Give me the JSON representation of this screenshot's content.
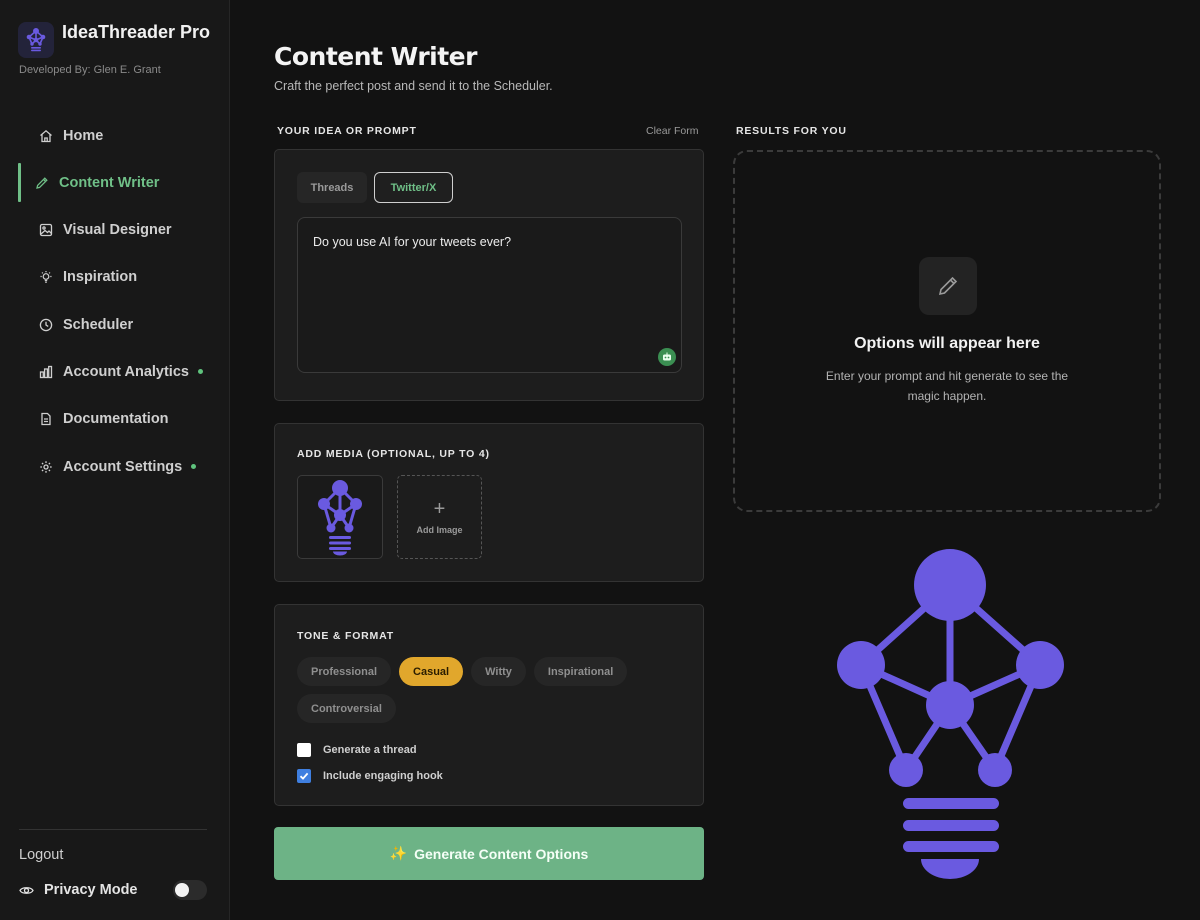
{
  "brand": {
    "title": "IdeaThreader Pro",
    "developer": "Developed By: Glen E. Grant"
  },
  "nav": {
    "items": [
      {
        "label": "Home",
        "icon": "home-icon",
        "active": false,
        "dot": false
      },
      {
        "label": "Content Writer",
        "icon": "pencil-icon",
        "active": true,
        "dot": false
      },
      {
        "label": "Visual Designer",
        "icon": "image-icon",
        "active": false,
        "dot": false
      },
      {
        "label": "Inspiration",
        "icon": "lightbulb-icon",
        "active": false,
        "dot": false
      },
      {
        "label": "Scheduler",
        "icon": "clock-icon",
        "active": false,
        "dot": false
      },
      {
        "label": "Account Analytics",
        "icon": "bar-chart-icon",
        "active": false,
        "dot": true
      },
      {
        "label": "Documentation",
        "icon": "document-icon",
        "active": false,
        "dot": false
      },
      {
        "label": "Account Settings",
        "icon": "settings-icon",
        "active": false,
        "dot": true
      }
    ],
    "logout": "Logout",
    "privacy_mode": "Privacy Mode",
    "privacy_enabled": false
  },
  "header": {
    "title": "Content Writer",
    "subtitle": "Craft the perfect post and send it to the Scheduler."
  },
  "prompt": {
    "label": "Your Idea or Prompt",
    "clear_label": "Clear Form",
    "tabs": [
      "Threads",
      "Twitter/X"
    ],
    "active_tab": "Twitter/X",
    "value": "Do you use AI for your tweets ever?"
  },
  "media": {
    "label": "ADD MEDIA (OPTIONAL, UP TO 4)",
    "add_label": "Add Image"
  },
  "tone": {
    "label": "TONE & FORMAT",
    "options": [
      "Professional",
      "Casual",
      "Witty",
      "Inspirational",
      "Controversial"
    ],
    "selected": "Casual",
    "checkboxes": [
      {
        "label": "Generate a thread",
        "checked": false
      },
      {
        "label": "Include engaging hook",
        "checked": true
      }
    ]
  },
  "generate_label": "Generate Content Options",
  "results": {
    "label": "Results for You",
    "empty_title": "Options will appear here",
    "empty_text": "Enter your prompt and hit generate to see the magic happen."
  },
  "colors": {
    "accent_green": "#6fbf87",
    "button_green": "#6db386",
    "chip_selected": "#e1a72c",
    "brand_purple": "#6a5ae0"
  }
}
